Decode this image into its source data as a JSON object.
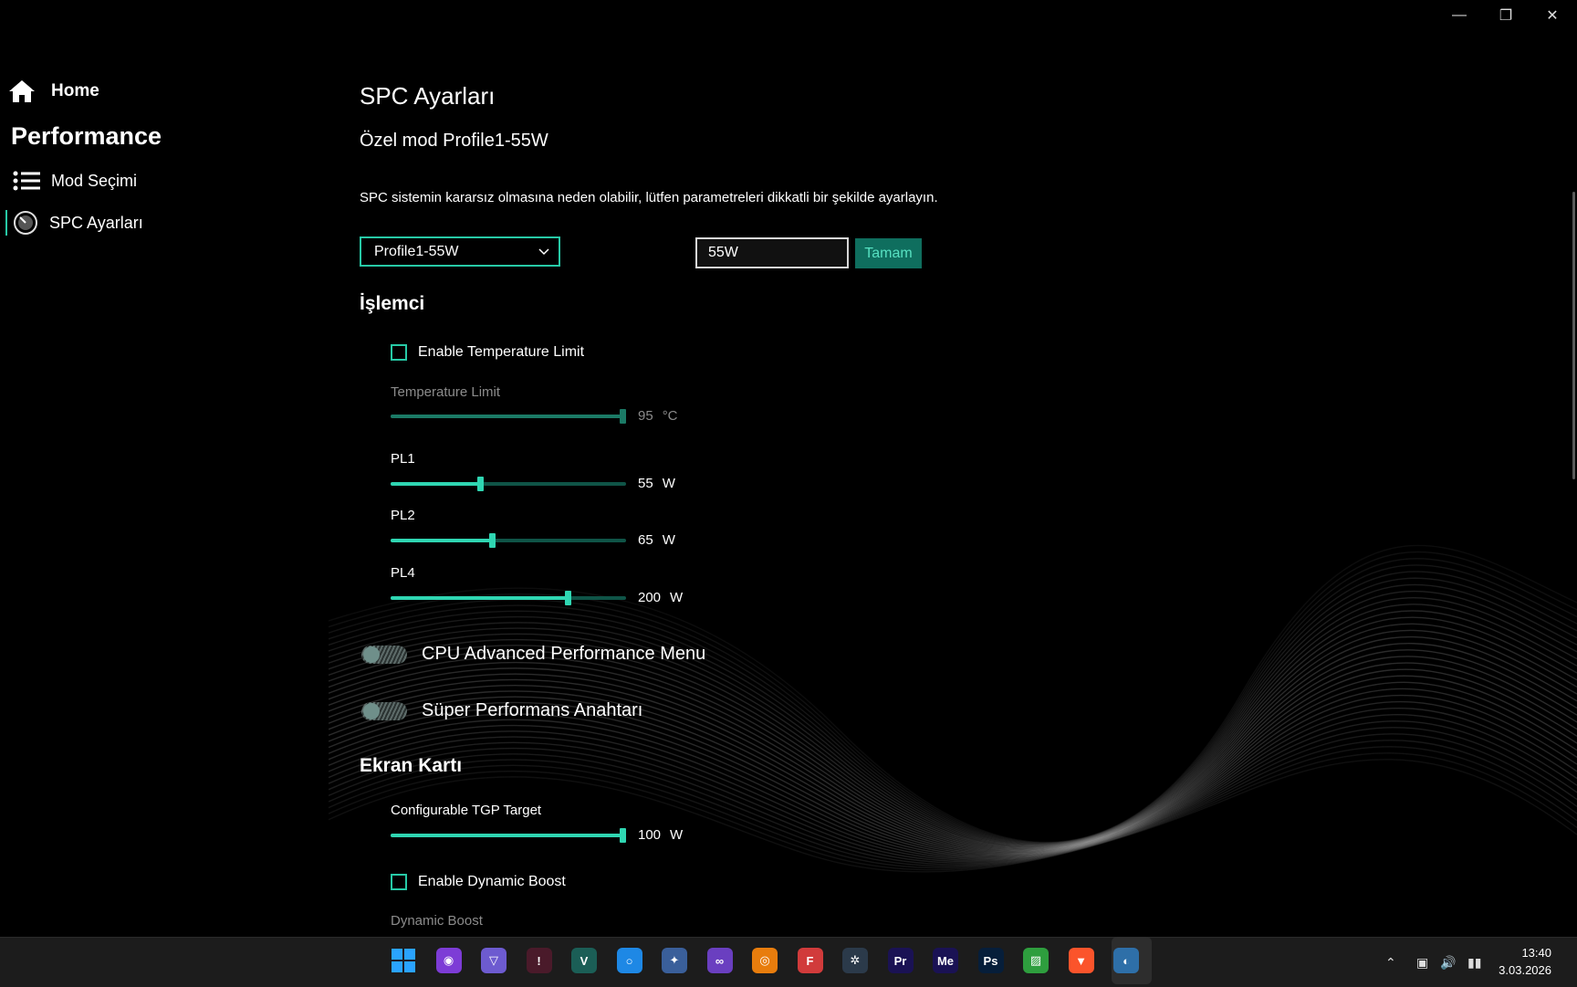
{
  "window": {
    "minimize_icon": "minimize-icon",
    "restore_icon": "restore-icon",
    "close_icon": "close-icon"
  },
  "sidebar": {
    "home_label": "Home",
    "section_title": "Performance",
    "items": [
      {
        "label": "Mod Seçimi",
        "icon": "list-icon"
      },
      {
        "label": "SPC Ayarları",
        "icon": "gauge-icon",
        "active": true
      }
    ]
  },
  "main": {
    "title": "SPC Ayarları",
    "subtitle": "Özel mod Profile1-55W",
    "warning": "SPC sistemin kararsız olmasına neden olabilir, lütfen parametreleri dikkatli bir şekilde ayarlayın.",
    "profile_select": {
      "value": "Profile1-55W"
    },
    "name_input": {
      "value": "55W"
    },
    "ok_button": "Tamam",
    "cpu": {
      "title": "İşlemci",
      "enable_temp_limit": {
        "label": "Enable Temperature Limit",
        "checked": false
      },
      "temp_limit": {
        "label": "Temperature Limit",
        "value": "95",
        "unit": "°C",
        "fraction": 1.0,
        "disabled": true
      },
      "pl1": {
        "label": "PL1",
        "value": "55",
        "unit": "W",
        "fraction": 0.38
      },
      "pl2": {
        "label": "PL2",
        "value": "65",
        "unit": "W",
        "fraction": 0.43
      },
      "pl4": {
        "label": "PL4",
        "value": "200",
        "unit": "W",
        "fraction": 0.75
      },
      "toggles": [
        {
          "label": "CPU Advanced Performance Menu",
          "on": false
        },
        {
          "label": "Süper Performans Anahtarı",
          "on": false
        }
      ]
    },
    "gpu": {
      "title": "Ekran Kartı",
      "tgp": {
        "label": "Configurable TGP Target",
        "value": "100",
        "unit": "W",
        "fraction": 1.0
      },
      "enable_dynamic_boost": {
        "label": "Enable Dynamic Boost",
        "checked": false
      },
      "dynamic_boost_label": "Dynamic Boost"
    }
  },
  "taskbar": {
    "apps": [
      {
        "name": "windows-start",
        "color": "#2a8cff",
        "text": ""
      },
      {
        "name": "tor-browser",
        "color": "#7d3cd6",
        "text": "◉"
      },
      {
        "name": "proton-vpn",
        "color": "#6d5bd0",
        "text": "▽"
      },
      {
        "name": "app-red",
        "color": "#4a1a2a",
        "text": "!"
      },
      {
        "name": "visual-paradigm",
        "color": "#1b5e56",
        "text": "V"
      },
      {
        "name": "app-blue",
        "color": "#1e88e5",
        "text": "○"
      },
      {
        "name": "app-bird",
        "color": "#3a5f9a",
        "text": "✦"
      },
      {
        "name": "visual-studio",
        "color": "#6a3fc0",
        "text": "∞"
      },
      {
        "name": "blender",
        "color": "#e87d0d",
        "text": "◎"
      },
      {
        "name": "fl-studio",
        "color": "#d13b3b",
        "text": "F"
      },
      {
        "name": "davinci-resolve",
        "color": "#2b3a4a",
        "text": "✲"
      },
      {
        "name": "premiere-pro",
        "color": "#1a1254",
        "text": "Pr"
      },
      {
        "name": "media-encoder",
        "color": "#1a1254",
        "text": "Me"
      },
      {
        "name": "photoshop",
        "color": "#061e3a",
        "text": "Ps"
      },
      {
        "name": "app-green",
        "color": "#2e9e3e",
        "text": "▨"
      },
      {
        "name": "brave-browser",
        "color": "#fb542b",
        "text": "▼"
      },
      {
        "name": "control-center",
        "color": "#2e6fa8",
        "text": "◐"
      }
    ],
    "clock_time": "13:40",
    "clock_date": "3.03.2026"
  }
}
